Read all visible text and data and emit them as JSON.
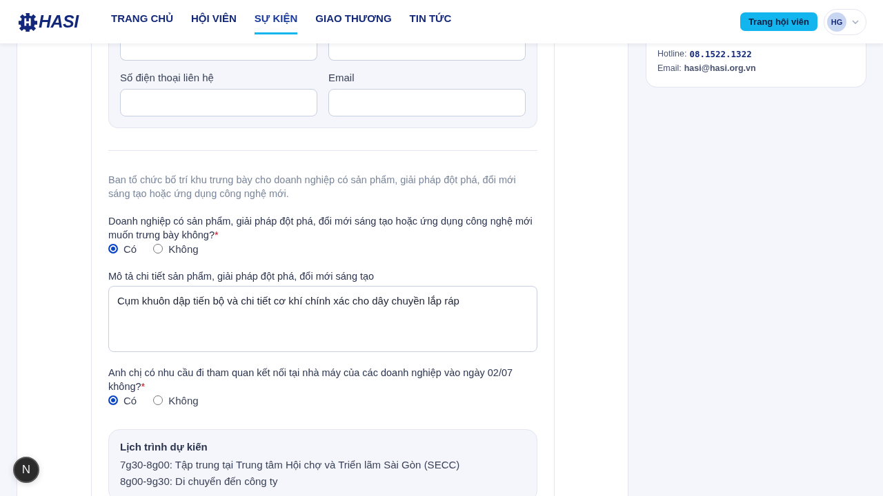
{
  "header": {
    "logo": "HASI",
    "nav": [
      {
        "label": "TRANG CHỦ",
        "selected": false
      },
      {
        "label": "HỘI VIÊN",
        "selected": false
      },
      {
        "label": "SỰ KIỆN",
        "selected": true
      },
      {
        "label": "GIAO THƯƠNG",
        "selected": false
      },
      {
        "label": "TIN TỨC",
        "selected": false
      }
    ],
    "member_button": "Trang hội viên",
    "avatar": "HG"
  },
  "form": {
    "contact_fields": [
      {
        "kind": "blank"
      },
      {
        "kind": "blank"
      },
      {
        "kind": "labeled",
        "label": "Số điện thoại liên hệ"
      },
      {
        "kind": "labeled",
        "label": "Email"
      }
    ],
    "intro": "Ban tổ chức bố trí khu trưng bày cho doanh nghiệp có sản phẩm, giải pháp đột phá, đổi mới sáng tạo hoặc ứng dụng công nghệ mới.",
    "questions": [
      {
        "kind": "radio",
        "label": "Doanh nghiệp có sản phẩm, giải pháp đột phá, đổi mới sáng tạo hoặc ứng dụng công nghệ mới muốn trưng bày không?",
        "required_mark": "*",
        "options": [
          {
            "label": "Có",
            "selected": true
          },
          {
            "label": "Không",
            "selected": false
          }
        ]
      },
      {
        "kind": "textarea",
        "label": "Mô tả chi tiết sản phẩm, giải pháp đột phá, đổi mới sáng tạo",
        "value": "Cụm khuôn dập tiến bộ và chi tiết cơ khí chính xác cho dây chuyền lắp ráp"
      },
      {
        "kind": "radio",
        "label": "Anh chị có nhu cầu đi tham quan kết nối tại nhà máy của các doanh nghiệp vào ngày 02/07 không?",
        "required_mark": "*",
        "options": [
          {
            "label": "Có",
            "selected": true
          },
          {
            "label": "Không",
            "selected": false
          }
        ]
      }
    ],
    "schedule": {
      "title": "Lịch trình dự kiến",
      "lines": [
        "7g30-8g00: Tập trung tại Trung tâm Hội chợ và Triển lãm Sài Gòn (SECC)",
        "8g00-9g30: Di chuyển đến công ty"
      ]
    }
  },
  "support": {
    "hotline_label": "Hotline:",
    "hotline": "08.1522.1322",
    "email_label": "Email:",
    "email": "hasi@hasi.org.vn"
  },
  "dev_badge": "N"
}
